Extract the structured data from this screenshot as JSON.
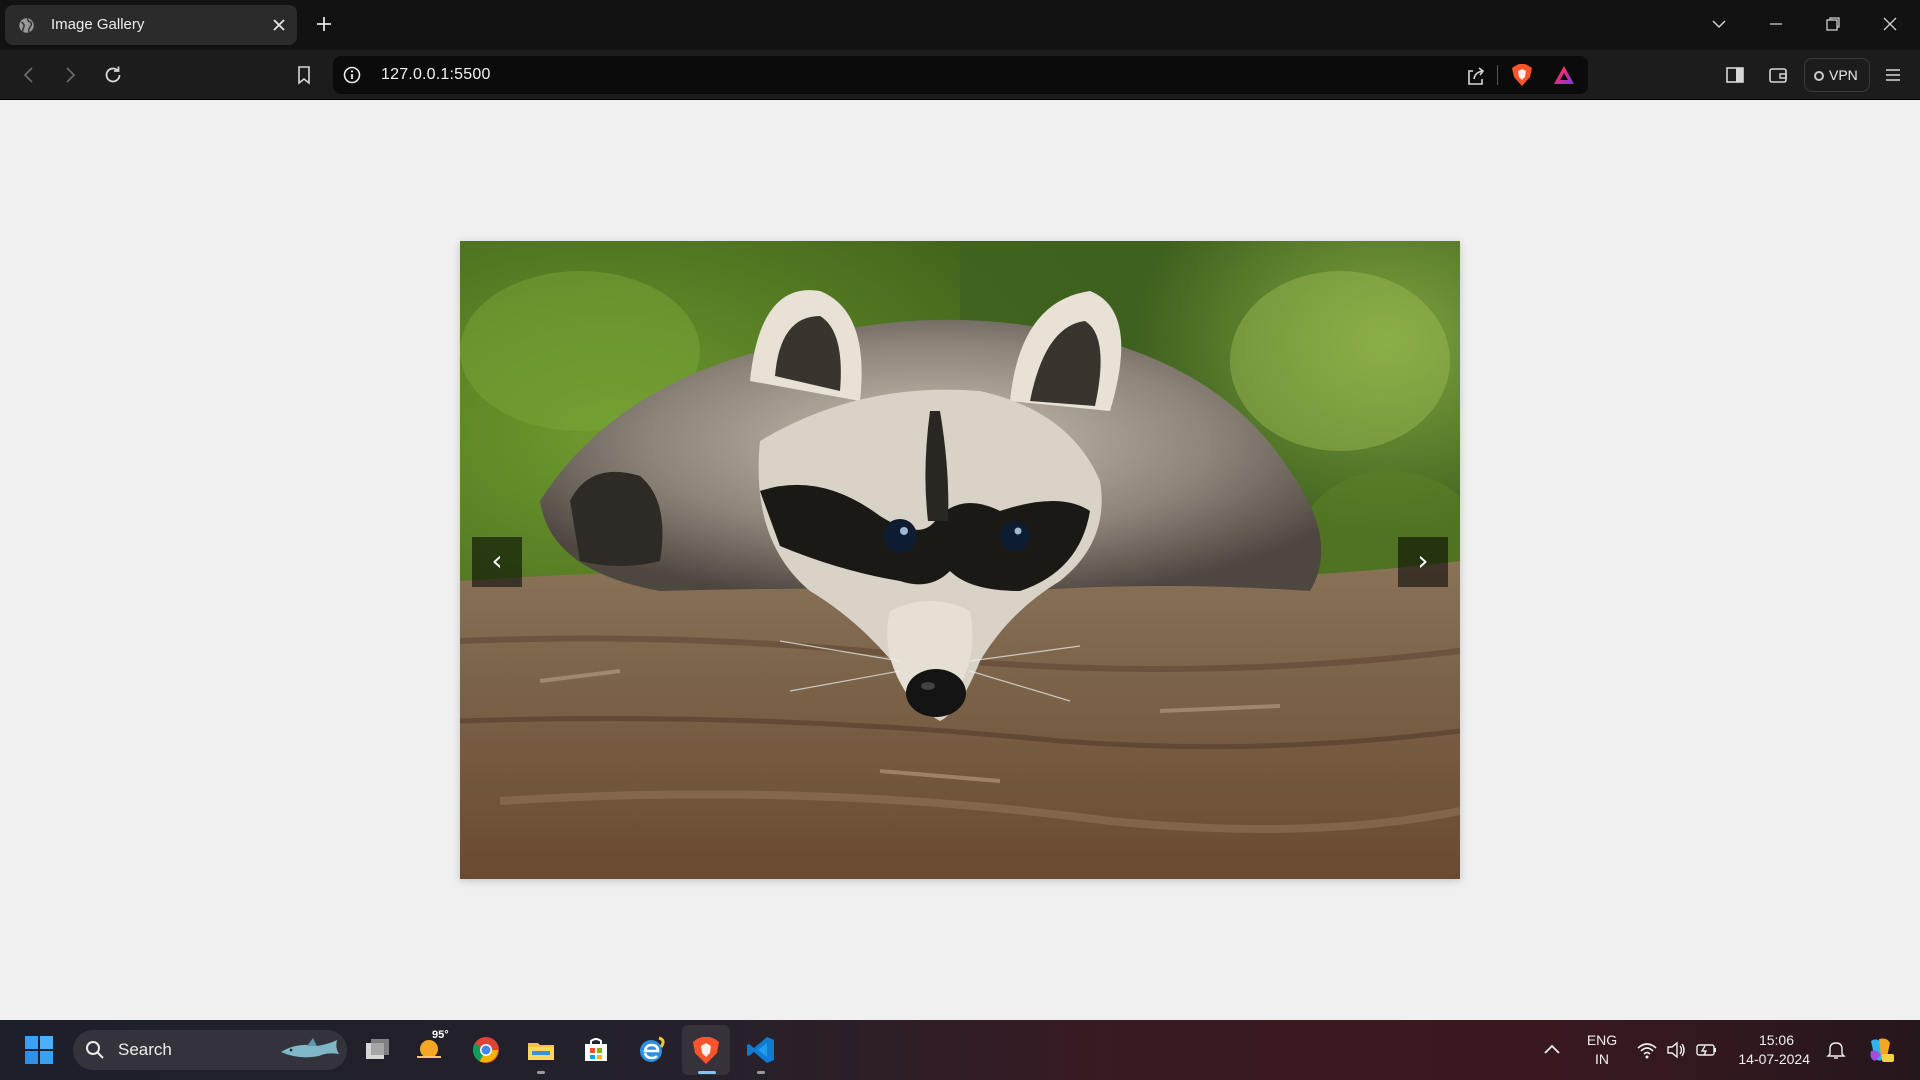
{
  "browser": {
    "tab": {
      "title": "Image Gallery"
    },
    "address": {
      "url": "127.0.0.1:5500"
    },
    "vpn_label": "VPN"
  },
  "gallery": {
    "image_subject": "raccoon resting on a log",
    "prev_label": "‹",
    "next_label": "›"
  },
  "taskbar": {
    "search_label": "Search",
    "weather_temp": "95°",
    "language": "ENG",
    "region": "IN",
    "time": "15:06",
    "date": "14-07-2024"
  },
  "colors": {
    "page_background": "#f0f0f0",
    "tab_strip": "#121212",
    "toolbar": "#1c1c1c",
    "brave_orange": "#fb542b"
  }
}
